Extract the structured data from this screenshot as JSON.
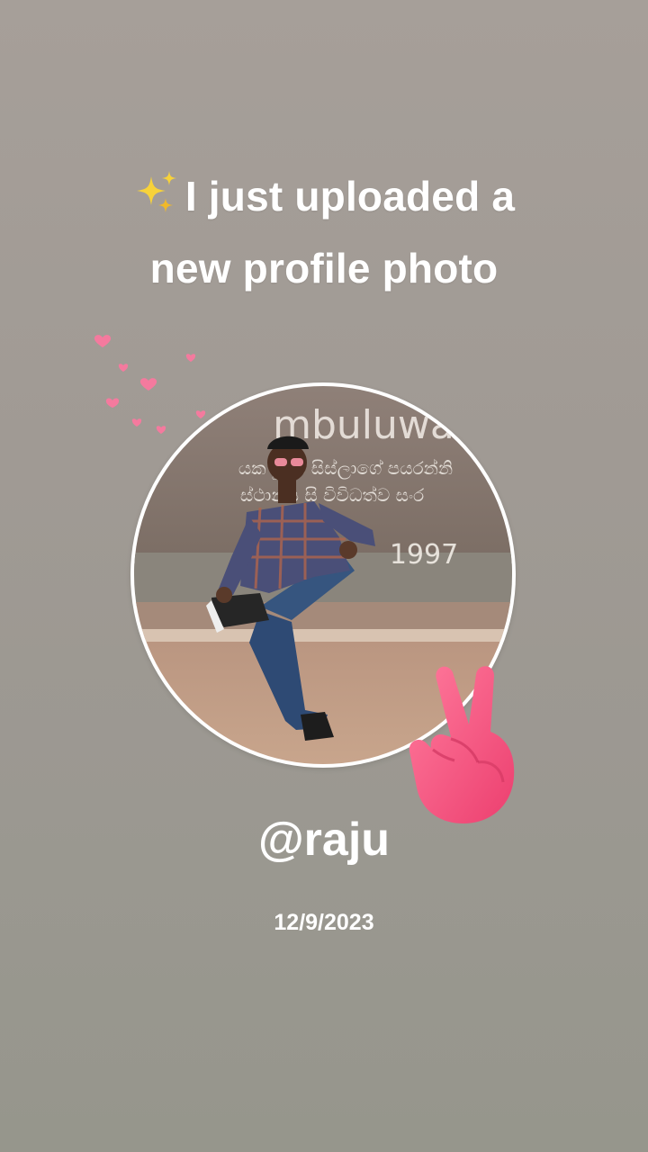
{
  "headline": {
    "emoji_icon": "sparkles-icon",
    "line1": "I just uploaded a",
    "line2": "new profile photo"
  },
  "decorations": {
    "hearts_icon": "floating-hearts-icon",
    "hearts_color": "#f47a9e",
    "hand_icon": "victory-hand-icon",
    "hand_color": "#f2557f"
  },
  "photo": {
    "sign_text": "mbuluwa",
    "sign_year": "1997",
    "sign_script_line1": "යක මුදිය සිස්ලාගේ පයරන්නි",
    "sign_script_line2": "ස්ථානය සි විවිධත්ව සංර"
  },
  "profile": {
    "handle": "@raju",
    "date": "12/9/2023"
  },
  "colors": {
    "text": "#ffffff",
    "background_top": "#a69f99",
    "background_bottom": "#96968c"
  }
}
